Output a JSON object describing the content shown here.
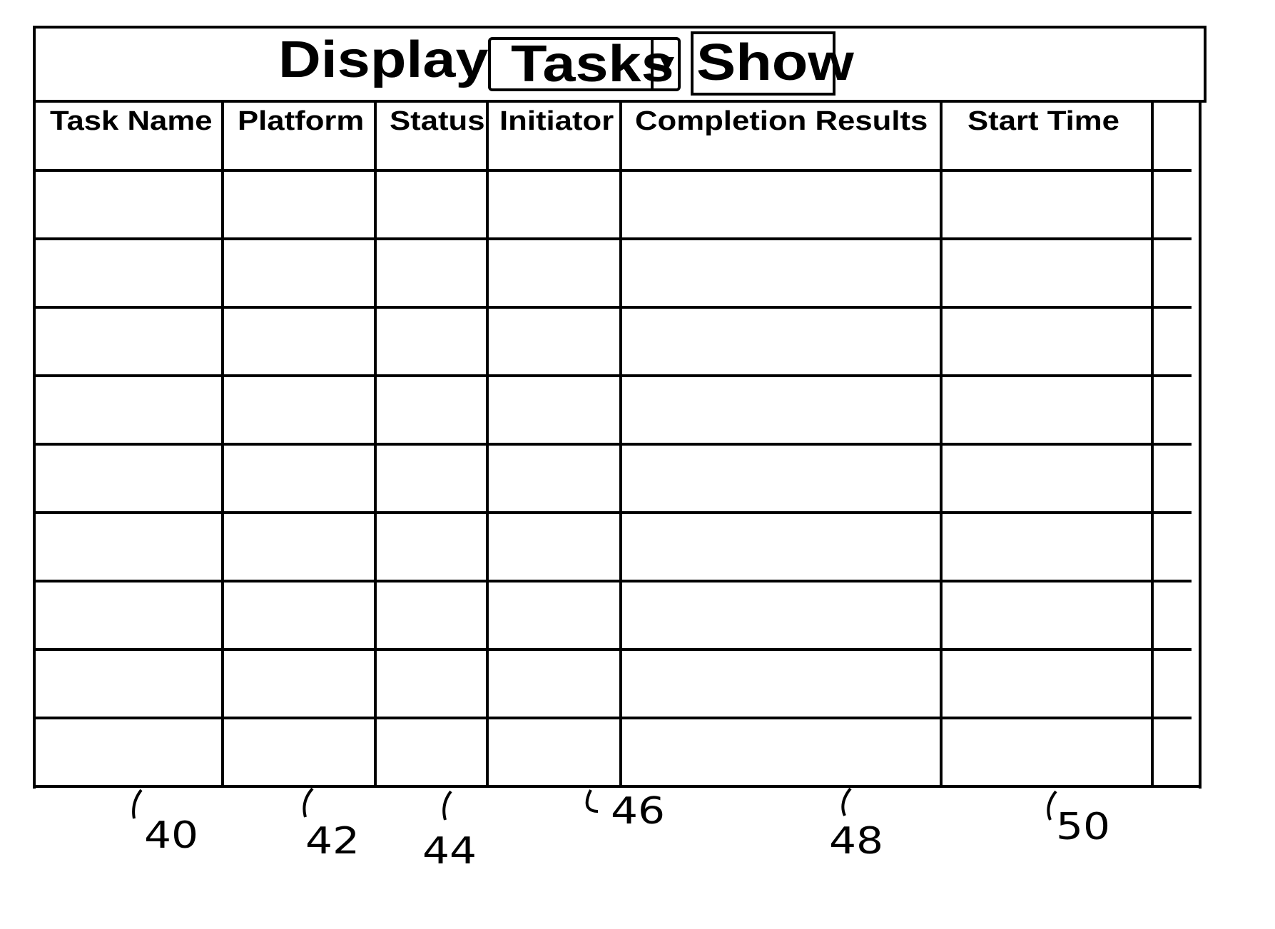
{
  "toolbar": {
    "display_label": "Display:",
    "display_select": {
      "selected": "Tasks",
      "arrow_icon": "dropdown-arrow-icon"
    },
    "show_button": "Show"
  },
  "table": {
    "columns": [
      {
        "label": "Task Name",
        "ref": "40"
      },
      {
        "label": "Platform",
        "ref": "42"
      },
      {
        "label": "Status",
        "ref": "44"
      },
      {
        "label": "Initiator",
        "ref": "46"
      },
      {
        "label": "Completion Results",
        "ref": "48"
      },
      {
        "label": "Start Time",
        "ref": "50"
      },
      {
        "label": "",
        "ref": ""
      }
    ],
    "rows": [
      [
        "",
        "",
        "",
        "",
        "",
        "",
        ""
      ],
      [
        "",
        "",
        "",
        "",
        "",
        "",
        ""
      ],
      [
        "",
        "",
        "",
        "",
        "",
        "",
        ""
      ],
      [
        "",
        "",
        "",
        "",
        "",
        "",
        ""
      ],
      [
        "",
        "",
        "",
        "",
        "",
        "",
        ""
      ],
      [
        "",
        "",
        "",
        "",
        "",
        "",
        ""
      ],
      [
        "",
        "",
        "",
        "",
        "",
        "",
        ""
      ],
      [
        "",
        "",
        "",
        "",
        "",
        "",
        ""
      ],
      [
        "",
        "",
        "",
        "",
        "",
        "",
        ""
      ]
    ]
  },
  "reference_numerals": [
    "40",
    "42",
    "44",
    "46",
    "48",
    "50"
  ]
}
